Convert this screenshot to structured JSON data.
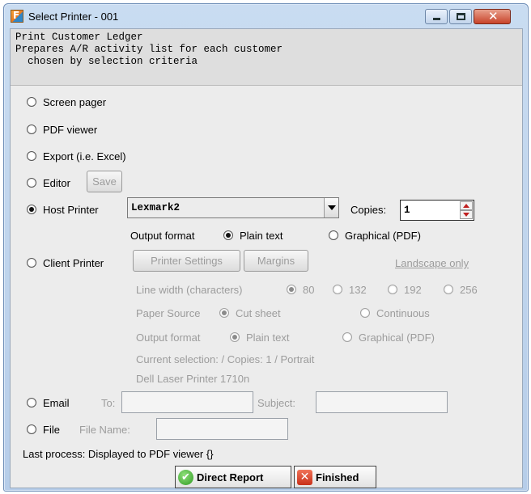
{
  "window": {
    "title": "Select Printer - 001"
  },
  "description": {
    "line1": "Print Customer Ledger",
    "line2": "Prepares A/R activity list for each customer",
    "line3": "  chosen by selection criteria"
  },
  "options": {
    "screen_pager": "Screen pager",
    "pdf_viewer": "PDF viewer",
    "export": "Export (i.e. Excel)",
    "editor": "Editor",
    "editor_save": "Save",
    "host_printer": "Host Printer",
    "client_printer": "Client Printer",
    "email": "Email",
    "file": "File"
  },
  "host": {
    "printer_value": "Lexmark2",
    "copies_label": "Copies:",
    "copies_value": "1",
    "output_format_label": "Output format",
    "plain_text": "Plain text",
    "graphical": "Graphical (PDF)"
  },
  "client": {
    "printer_settings": "Printer Settings",
    "margins": "Margins",
    "landscape_only": "Landscape only",
    "line_width_label": "Line width (characters)",
    "widths": [
      "80",
      "132",
      "192",
      "256"
    ],
    "paper_source_label": "Paper Source",
    "cut_sheet": "Cut sheet",
    "continuous": "Continuous",
    "output_format_label": "Output format",
    "plain_text": "Plain text",
    "graphical": "Graphical (PDF)",
    "current_selection": "Current selection:  / Copies: 1  / Portrait",
    "printer_name": "Dell Laser Printer 1710n"
  },
  "email": {
    "to_label": "To:",
    "subject_label": "Subject:"
  },
  "file": {
    "name_label": "File Name:"
  },
  "status": {
    "last_process": "Last process: Displayed to PDF viewer {}"
  },
  "buttons": {
    "direct_report": "Direct Report",
    "finished": "Finished"
  }
}
